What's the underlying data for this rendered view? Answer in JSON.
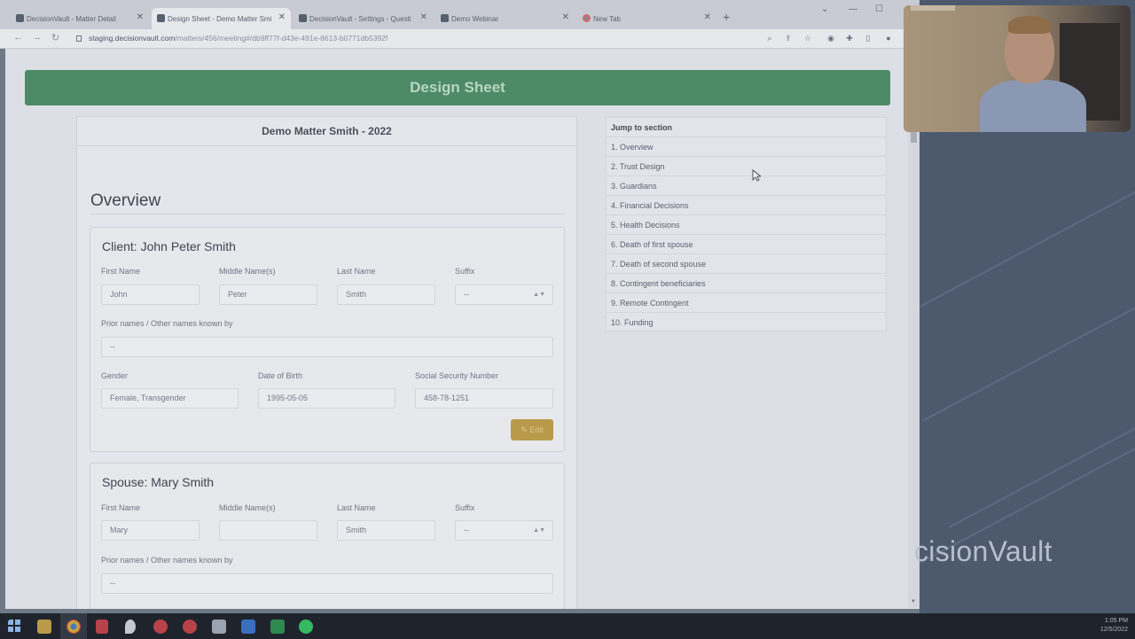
{
  "browser": {
    "tabs": [
      {
        "title": "DecisionVault - Matter Detail"
      },
      {
        "title": "Design Sheet - Demo Matter Smi"
      },
      {
        "title": "DecisionVault - Settings - Questi"
      },
      {
        "title": "Demo Webinar"
      },
      {
        "title": "New Tab"
      }
    ],
    "url_host": "staging.decisionvault.com",
    "url_path": "/matters/456/meeting#/db9ff77f-d43e-491e-8613-b0771db5392f"
  },
  "page": {
    "banner_title": "Design Sheet",
    "matter_title": "Demo Matter Smith - 2022",
    "section_title": "Overview",
    "client": {
      "heading": "Client: John Peter Smith",
      "labels": {
        "first_name": "First Name",
        "middle_name": "Middle Name(s)",
        "last_name": "Last Name",
        "suffix": "Suffix",
        "prior_names": "Prior names / Other names known by",
        "gender": "Gender",
        "dob": "Date of Birth",
        "ssn": "Social Security Number"
      },
      "values": {
        "first_name": "John",
        "middle_name": "Peter",
        "last_name": "Smith",
        "suffix": "--",
        "prior_names": "--",
        "gender": "Female, Transgender",
        "dob": "1995-05-05",
        "ssn": "458-78-1251"
      },
      "edit_label": "Edit"
    },
    "spouse": {
      "heading": "Spouse: Mary Smith",
      "labels": {
        "first_name": "First Name",
        "middle_name": "Middle Name(s)",
        "last_name": "Last Name",
        "suffix": "Suffix",
        "prior_names": "Prior names / Other names known by"
      },
      "values": {
        "first_name": "Mary",
        "middle_name": "",
        "last_name": "Smith",
        "suffix": "--",
        "prior_names": "--"
      }
    },
    "jump": {
      "heading": "Jump to section",
      "items": [
        "1. Overview",
        "2. Trust Design",
        "3. Guardians",
        "4. Financial Decisions",
        "5. Health Decisions",
        "6. Death of first spouse",
        "7. Death of second spouse",
        "8. Contingent beneficiaries",
        "9. Remote Contingent",
        "10. Funding"
      ]
    }
  },
  "brand_text": "cisionVault",
  "taskbar": {
    "time": "1:05 PM",
    "date": "12/5/2022"
  },
  "colors": {
    "banner": "#4e8a66",
    "edit_button": "#b89a4a",
    "side_panel": "#4d5a6e"
  }
}
